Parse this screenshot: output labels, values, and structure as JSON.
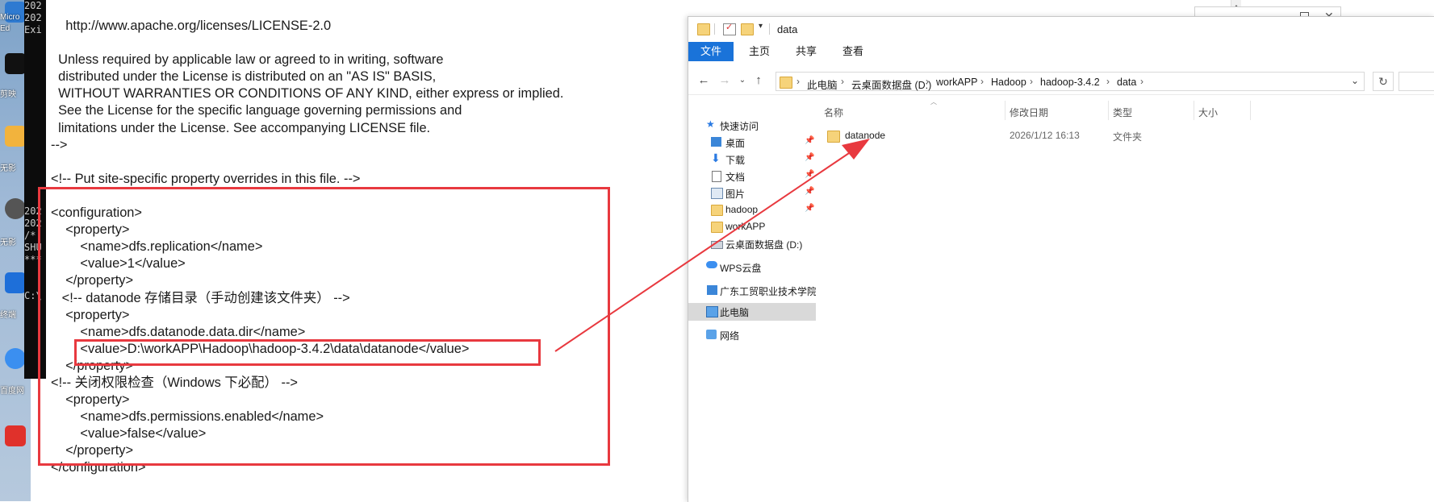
{
  "desktop": {
    "labels": [
      "Micro",
      "Ed",
      "剪映",
      "无影",
      "无影",
      "终端",
      "百度网"
    ]
  },
  "console": {
    "lines": [
      "202",
      "202",
      "Exi",
      "",
      "",
      "",
      "",
      "",
      "",
      "",
      "",
      "",
      "",
      "",
      "",
      "",
      "",
      "202",
      "202",
      "/*",
      "SHU",
      "***",
      "",
      "",
      "C:\\"
    ]
  },
  "notepad": {
    "lines": [
      "    http://www.apache.org/licenses/LICENSE-2.0",
      "",
      "  Unless required by applicable law or agreed to in writing, software",
      "  distributed under the License is distributed on an \"AS IS\" BASIS,",
      "  WITHOUT WARRANTIES OR CONDITIONS OF ANY KIND, either express or implied.",
      "  See the License for the specific language governing permissions and",
      "  limitations under the License. See accompanying LICENSE file.",
      "-->",
      "",
      "<!-- Put site-specific property overrides in this file. -->",
      "",
      "<configuration>",
      "    <property>",
      "        <name>dfs.replication</name>",
      "        <value>1</value>",
      "    </property>",
      "   <!-- datanode 存储目录（手动创建该文件夹） -->",
      "    <property>",
      "        <name>dfs.datanode.data.dir</name>",
      "        <value>D:\\workAPP\\Hadoop\\hadoop-3.4.2\\data\\datanode</value>",
      "    </property>",
      "<!-- 关闭权限检查（Windows 下必配） -->",
      "    <property>",
      "        <name>dfs.permissions.enabled</name>",
      "        <value>false</value>",
      "    </property>",
      "</configuration>"
    ]
  },
  "explorer": {
    "title": "data",
    "ribbon_tabs": [
      "文件",
      "主页",
      "共享",
      "查看"
    ],
    "breadcrumb": [
      "此电脑",
      "云桌面数据盘 (D:)",
      "workAPP",
      "Hadoop",
      "hadoop-3.4.2",
      "data"
    ],
    "nav": {
      "quick_access": "快速访问",
      "desktop": "桌面",
      "downloads": "下载",
      "documents": "文档",
      "pictures": "图片",
      "hadoop": "hadoop",
      "workapp": "workAPP",
      "drive_d": "云桌面数据盘 (D:)",
      "wps": "WPS云盘",
      "school": "广东工贸职业技术学院",
      "thispc": "此电脑",
      "network": "网络"
    },
    "columns": {
      "name": "名称",
      "modified": "修改日期",
      "type": "类型",
      "size": "大小"
    },
    "files": [
      {
        "name": "datanode",
        "modified": "2026/1/12 16:13",
        "type": "文件夹",
        "size": ""
      }
    ]
  },
  "colors": {
    "highlight": "#e8393f",
    "accent": "#1a73d9",
    "folder": "#f6d37a"
  }
}
